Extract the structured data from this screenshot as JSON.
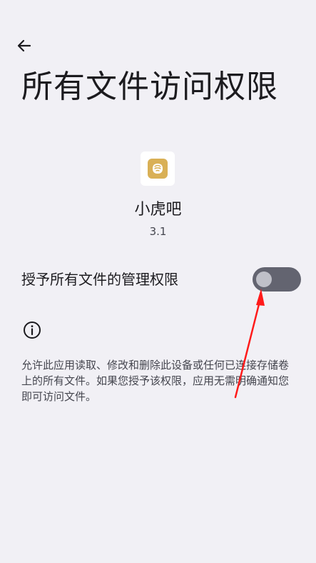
{
  "header": {
    "back_icon": "arrow-left-icon",
    "title": "所有文件访问权限"
  },
  "app": {
    "icon": "tiger-app-icon",
    "icon_color": "#d9b056",
    "name": "小虎吧",
    "version": "3.1"
  },
  "permission": {
    "label": "授予所有文件的管理权限",
    "enabled": false,
    "track_color": "#636470",
    "knob_color": "#bfc0c8"
  },
  "info": {
    "icon": "info-icon",
    "description": "允许此应用读取、修改和删除此设备或任何已连接存储卷上的所有文件。如果您授予该权限，应用无需明确通知您即可访问文件。"
  },
  "annotation": {
    "arrow_color": "#ff1a1a"
  },
  "theme": {
    "background": "#f1f0f5",
    "text_primary": "#1c1b1f",
    "text_secondary": "#45464f"
  }
}
